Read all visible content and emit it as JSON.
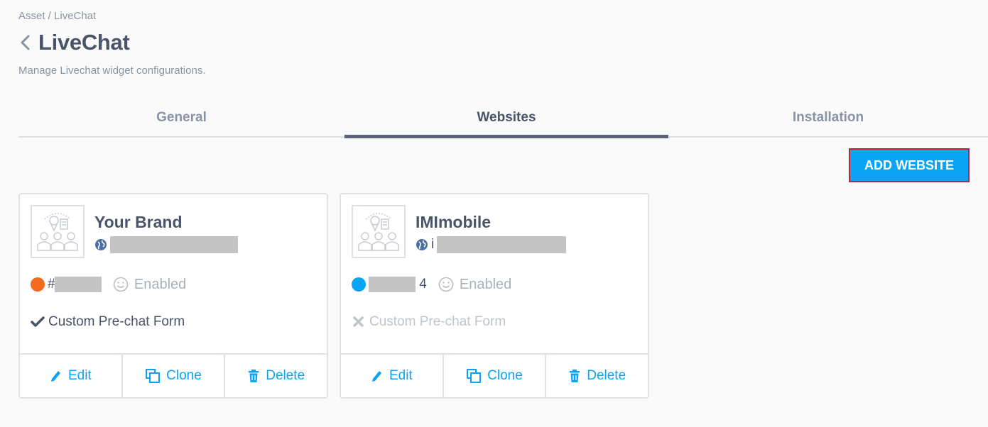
{
  "breadcrumb": "Asset / LiveChat",
  "page_title": "LiveChat",
  "subtitle": "Manage Livechat widget configurations.",
  "tabs": [
    {
      "label": "General",
      "active": false
    },
    {
      "label": "Websites",
      "active": true
    },
    {
      "label": "Installation",
      "active": false
    }
  ],
  "add_button_label": "ADD WEBSITE",
  "colors": {
    "accent": "#0aa4f4",
    "orange_dot": "#f26a1b",
    "blue_dot": "#0aa4f4"
  },
  "cards": [
    {
      "name": "Your Brand",
      "url_prefix": "",
      "color_prefix": "#",
      "color_suffix": "",
      "dot_color": "#f26a1b",
      "status": "Enabled",
      "form_label": "Custom Pre-chat Form",
      "form_enabled": true,
      "form_icon": "check-icon",
      "actions": {
        "edit": "Edit",
        "clone": "Clone",
        "delete": "Delete"
      }
    },
    {
      "name": "IMImobile",
      "url_prefix": "i",
      "color_prefix": "",
      "color_suffix": "4",
      "dot_color": "#0aa4f4",
      "status": "Enabled",
      "form_label": "Custom Pre-chat Form",
      "form_enabled": false,
      "form_icon": "cross-icon",
      "actions": {
        "edit": "Edit",
        "clone": "Clone",
        "delete": "Delete"
      }
    }
  ]
}
